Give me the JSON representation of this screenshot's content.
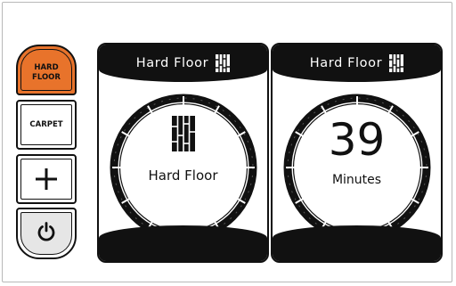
{
  "controls": {
    "hard_floor_button": "HARD\nFLOOR",
    "carpet_button": "CARPET",
    "plus_button_icon": "plus-icon",
    "power_button_icon": "power-icon"
  },
  "panels": [
    {
      "header_title": "Hard Floor",
      "header_icon": "hard-floor-icon",
      "center_icon": "hard-floor-icon",
      "center_label": "Hard Floor"
    },
    {
      "header_title": "Hard Floor",
      "header_icon": "hard-floor-icon",
      "value": "39",
      "unit": "Minutes"
    }
  ],
  "colors": {
    "accent": "#e8732b",
    "display_black": "#111111",
    "power_bg": "#e6e6e6"
  }
}
